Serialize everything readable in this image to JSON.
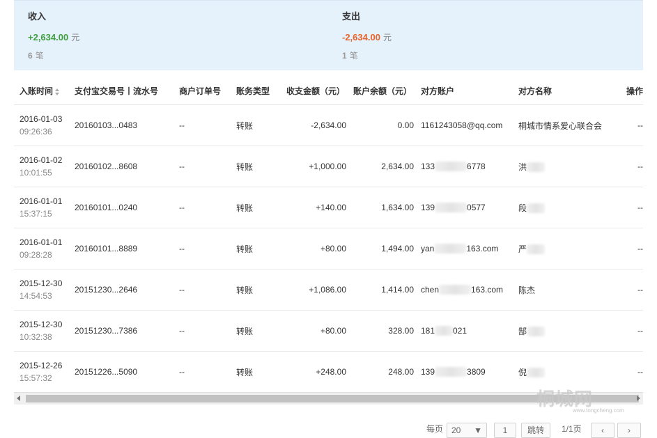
{
  "summary": {
    "income": {
      "title": "收入",
      "amount": "+2,634.00",
      "unit": "元",
      "count": "6",
      "count_unit": "笔"
    },
    "expense": {
      "title": "支出",
      "amount": "-2,634.00",
      "unit": "元",
      "count": "1",
      "count_unit": "笔"
    }
  },
  "table": {
    "headers": [
      "入账时间",
      "支付宝交易号丨流水号",
      "商户订单号",
      "账务类型",
      "收支金额（元）",
      "账户余额（元）",
      "对方账户",
      "对方名称",
      "操作"
    ],
    "rows": [
      {
        "date": "2016-01-03",
        "time": "09:26:36",
        "trade_no": "20160103...0483",
        "order_no": "--",
        "type": "转账",
        "amount": "-2,634.00",
        "balance": "0.00",
        "account_a": "1161243058@qq.com",
        "account_b": "",
        "name_a": "桐城市情系爱心联合会",
        "name_blur": false,
        "op": "--"
      },
      {
        "date": "2016-01-02",
        "time": "10:01:55",
        "trade_no": "20160102...8608",
        "order_no": "--",
        "type": "转账",
        "amount": "+1,000.00",
        "balance": "2,634.00",
        "account_a": "133",
        "account_b": "6778",
        "name_a": "洪",
        "name_blur": true,
        "op": "--"
      },
      {
        "date": "2016-01-01",
        "time": "15:37:15",
        "trade_no": "20160101...0240",
        "order_no": "--",
        "type": "转账",
        "amount": "+140.00",
        "balance": "1,634.00",
        "account_a": "139",
        "account_b": "0577",
        "name_a": "段",
        "name_blur": true,
        "op": "--"
      },
      {
        "date": "2016-01-01",
        "time": "09:28:28",
        "trade_no": "20160101...8889",
        "order_no": "--",
        "type": "转账",
        "amount": "+80.00",
        "balance": "1,494.00",
        "account_a": "yan",
        "account_b": "163.com",
        "name_a": "严",
        "name_blur": true,
        "op": "--"
      },
      {
        "date": "2015-12-30",
        "time": "14:54:53",
        "trade_no": "20151230...2646",
        "order_no": "--",
        "type": "转账",
        "amount": "+1,086.00",
        "balance": "1,414.00",
        "account_a": "chen",
        "account_b": "163.com",
        "name_a": "陈杰",
        "name_blur": false,
        "op": "--"
      },
      {
        "date": "2015-12-30",
        "time": "10:32:38",
        "trade_no": "20151230...7386",
        "order_no": "--",
        "type": "转账",
        "amount": "+80.00",
        "balance": "328.00",
        "account_a": "181",
        "account_b": "021",
        "name_a": "郜",
        "name_blur": true,
        "op": "--"
      },
      {
        "date": "2015-12-26",
        "time": "15:57:32",
        "trade_no": "20151226...5090",
        "order_no": "--",
        "type": "转账",
        "amount": "+248.00",
        "balance": "248.00",
        "account_a": "139",
        "account_b": "3809",
        "name_a": "倪",
        "name_blur": true,
        "op": "--"
      }
    ]
  },
  "pager": {
    "per_page_label": "每页",
    "per_page_value": "20",
    "page_input": "1",
    "jump_label": "跳转",
    "page_info": "1/1页"
  },
  "watermark": {
    "text": "桐城网",
    "sub": "www.tongcheng.com"
  }
}
